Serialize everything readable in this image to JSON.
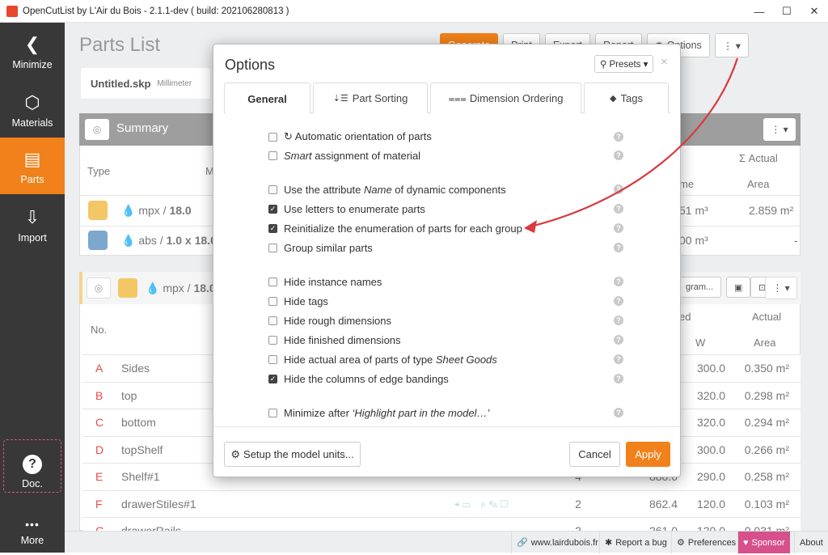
{
  "window": {
    "title": "OpenCutList by L'Air du Bois - 2.1.1-dev ( build: 202106280813 )",
    "minimize": "—",
    "maximize": "☐",
    "close": "✕"
  },
  "sidebar": {
    "items": [
      {
        "label": "Minimize",
        "icon": "chevron-left-icon",
        "glyph": "❮"
      },
      {
        "label": "Materials",
        "icon": "materials-icon",
        "glyph": "⬡"
      },
      {
        "label": "Parts",
        "icon": "parts-list-icon",
        "glyph": "▤"
      },
      {
        "label": "Import",
        "icon": "import-icon",
        "glyph": "⇩"
      },
      {
        "label": "Doc.",
        "icon": "question-icon",
        "glyph": "?"
      },
      {
        "label": "More",
        "icon": "more-dots-icon",
        "glyph": "•••"
      }
    ]
  },
  "main": {
    "title": "Parts List",
    "toolbar": {
      "generate": "Generate",
      "print": "Print",
      "export": "Export",
      "report": "Report",
      "options": "Options",
      "more": "⋮ ▾"
    },
    "file": {
      "name": "Untitled.skp",
      "unit": "Millimeter"
    },
    "summary": {
      "title": "Summary",
      "col_type": "Type",
      "col_m": "M",
      "col_actual": "Σ Actual",
      "col_volume": "me",
      "col_area": "Area",
      "rows": [
        {
          "mat": "mpx",
          "thick": "18.0",
          "vol": "51 m³",
          "area": "2.859 m²"
        },
        {
          "mat": "abs",
          "thick": "1.0 x 18.0",
          "vol": "00 m³",
          "area": "-"
        }
      ]
    },
    "group": {
      "mat": "mpx",
      "thick": "18.0",
      "diagram": "gram...",
      "col_no": "No.",
      "col_ed": "ed",
      "col_actual": "Actual",
      "col_w": "W",
      "col_area": "Area"
    },
    "parts": [
      {
        "letter": "A",
        "name": "Sides",
        "qty": "",
        "len": "",
        "width": "300.0",
        "area": "0.350 m²"
      },
      {
        "letter": "B",
        "name": "top",
        "qty": "",
        "len": "",
        "width": "320.0",
        "area": "0.298 m²"
      },
      {
        "letter": "C",
        "name": "bottom",
        "qty": "",
        "len": "",
        "width": "320.0",
        "area": "0.294 m²"
      },
      {
        "letter": "D",
        "name": "topShelf",
        "qty": "",
        "len": "",
        "width": "300.0",
        "area": "0.266 m²"
      },
      {
        "letter": "E",
        "name": "Shelf#1",
        "qty": "4",
        "len": "880.0",
        "width": "290.0",
        "area": "0.258 m²"
      },
      {
        "letter": "F",
        "name": "drawerStiles#1",
        "qty": "2",
        "len": "862.4",
        "width": "120.0",
        "area": "0.103 m²"
      },
      {
        "letter": "G",
        "name": "drawerRails",
        "qty": "2",
        "len": "261.0",
        "width": "120.0",
        "area": "0.031 m²"
      }
    ]
  },
  "dialog": {
    "title": "Options",
    "presets": "Presets ▾",
    "close": "×",
    "tabs": [
      {
        "label": "General",
        "icon": ""
      },
      {
        "label": "Part Sorting",
        "icon": "sort-icon",
        "glyph": "⇣☰"
      },
      {
        "label": "Dimension Ordering",
        "icon": "dimension-icon",
        "glyph": "⩶"
      },
      {
        "label": "Tags",
        "icon": "tag-icon",
        "glyph": "🏷"
      }
    ],
    "options": [
      {
        "pre": "",
        "em": "",
        "post": "Automatic orientation of parts",
        "checked": false,
        "lead_icon": "↻ "
      },
      {
        "pre": "",
        "em": "Smart",
        "post": " assignment of material",
        "checked": false
      },
      {
        "pre": "Use the attribute ",
        "em": "Name",
        "post": " of dynamic components",
        "checked": false
      },
      {
        "pre": "",
        "em": "",
        "post": "Use letters to enumerate parts",
        "checked": true
      },
      {
        "pre": "",
        "em": "",
        "post": "Reinitialize the enumeration of parts for each group",
        "checked": true
      },
      {
        "pre": "",
        "em": "",
        "post": "Group similar parts",
        "checked": false
      },
      {
        "pre": "",
        "em": "",
        "post": "Hide instance names",
        "checked": false
      },
      {
        "pre": "",
        "em": "",
        "post": "Hide tags",
        "checked": false
      },
      {
        "pre": "",
        "em": "",
        "post": "Hide rough dimensions",
        "checked": false
      },
      {
        "pre": "",
        "em": "",
        "post": "Hide finished dimensions",
        "checked": false
      },
      {
        "pre": "Hide actual area of parts of type ",
        "em": "Sheet Goods",
        "post": "",
        "checked": false
      },
      {
        "pre": "",
        "em": "",
        "post": "Hide the columns of edge bandings",
        "checked": true
      },
      {
        "pre": "Minimize after ",
        "em": "‘Highlight part in the model…’",
        "post": "",
        "checked": false
      }
    ],
    "setup_units": "Setup the model units...",
    "cancel": "Cancel",
    "apply": "Apply"
  },
  "statusbar": {
    "site": "www.lairdubois.fr",
    "bug": "Report a bug",
    "prefs": "Preferences",
    "sponsor": "Sponsor",
    "about": "About"
  },
  "colors": {
    "accent": "#f1811a",
    "sidebar": "#383838",
    "sponsor": "#d6508b",
    "annotation_arrow": "#d9393f"
  }
}
